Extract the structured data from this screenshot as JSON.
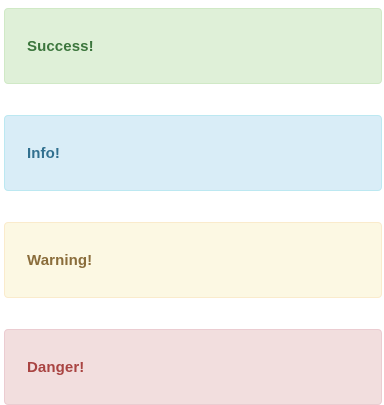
{
  "alerts": {
    "success": {
      "label": "Success!",
      "color": "#3c763d",
      "background": "#dff0d8"
    },
    "info": {
      "label": "Info!",
      "color": "#31708f",
      "background": "#d9edf7"
    },
    "warning": {
      "label": "Warning!",
      "color": "#8a6d3b",
      "background": "#fcf8e3"
    },
    "danger": {
      "label": "Danger!",
      "color": "#a94442",
      "background": "#f2dede"
    }
  }
}
